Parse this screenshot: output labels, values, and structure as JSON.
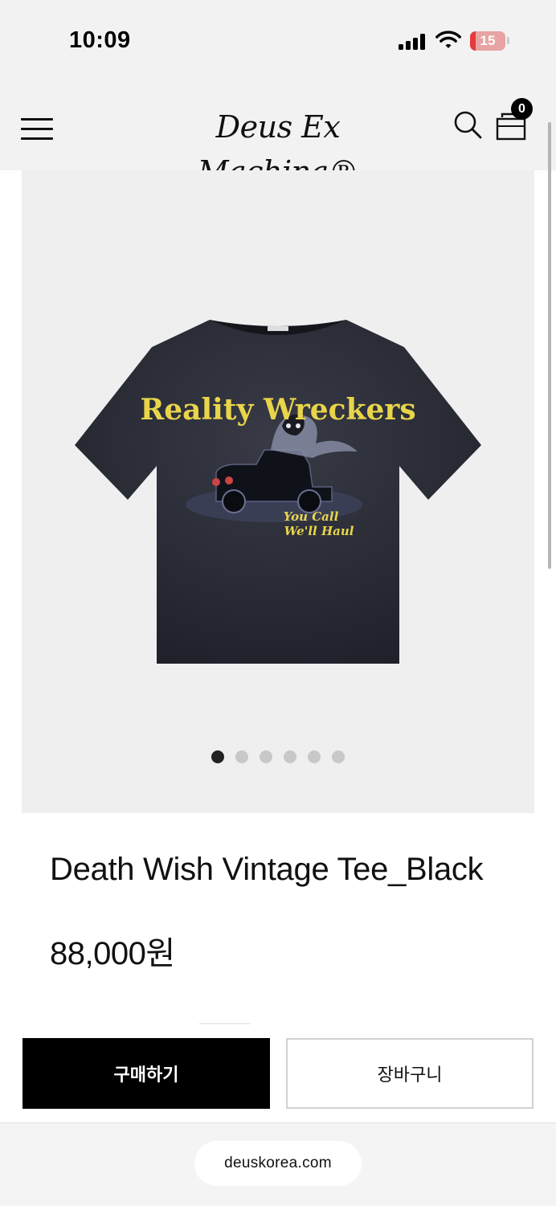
{
  "status_bar": {
    "time": "10:09",
    "battery": "15",
    "battery_level": 0.15,
    "signal_icon": "cellular-signal-icon",
    "wifi_icon": "wifi-icon"
  },
  "header": {
    "menu_icon": "hamburger-menu-icon",
    "logo_text": "Deus Ex Machina®",
    "search_icon": "search-icon",
    "cart_icon": "shopping-bag-icon",
    "cart_count": "0"
  },
  "product_image": {
    "graphic_title": "Reality Wreckers",
    "graphic_tagline_1": "You Call",
    "graphic_tagline_2": "We'll Haul",
    "shirt_color": "#2a2c36",
    "print_color": "#e8d54a"
  },
  "gallery": {
    "slide_count": 6,
    "active_slide": 1
  },
  "product": {
    "title": "Death Wish Vintage Tee_Black",
    "price": "88,000원"
  },
  "actions": {
    "buy_label": "구매하기",
    "cart_label": "장바구니"
  },
  "browser": {
    "url": "deuskorea.com"
  },
  "colors": {
    "header_bg": "#f2f2f2",
    "gallery_bg": "#efefef",
    "primary_button": "#000000",
    "battery_red": "#e33b3b"
  }
}
